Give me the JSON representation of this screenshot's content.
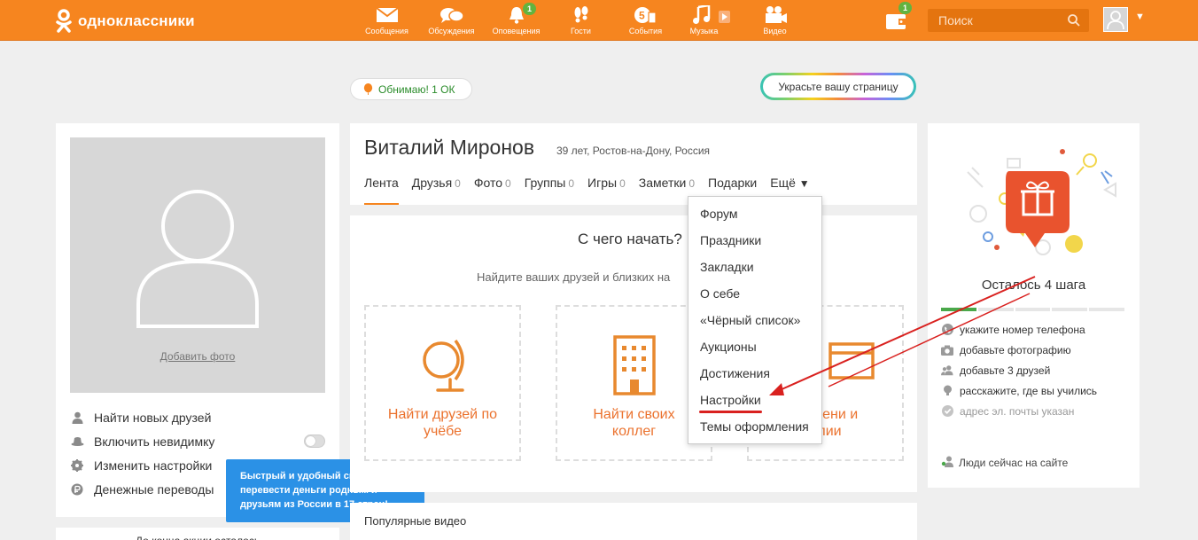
{
  "header": {
    "logo_text": "одноклассники",
    "nav": [
      {
        "label": "Сообщения",
        "icon": "envelope-icon",
        "badge": ""
      },
      {
        "label": "Обсуждения",
        "icon": "chat-bubbles-icon",
        "badge": ""
      },
      {
        "label": "Оповещения",
        "icon": "bell-icon",
        "badge": "1"
      },
      {
        "label": "Гости",
        "icon": "footprints-icon",
        "badge": ""
      },
      {
        "label": "События",
        "icon": "events-five-icon",
        "badge": ""
      },
      {
        "label": "Музыка",
        "icon": "music-note-icon",
        "badge": ""
      },
      {
        "label": "Видео",
        "icon": "video-camera-icon",
        "badge": ""
      }
    ],
    "wallet_badge": "1",
    "search_placeholder": "Поиск",
    "accent_color": "#f6851f"
  },
  "pills": {
    "ok_text": "Обнимаю! 1 ОК",
    "decorate_text": "Украсьте вашу страницу"
  },
  "left": {
    "add_photo": "Добавить фото",
    "menu": [
      {
        "label": "Найти новых друзей",
        "icon": "person-icon"
      },
      {
        "label": "Включить невидимку",
        "icon": "hat-icon"
      },
      {
        "label": "Изменить настройки",
        "icon": "gear-icon"
      },
      {
        "label": "Денежные переводы",
        "icon": "ruble-icon"
      }
    ],
    "bottom_text": "До конца акции осталось"
  },
  "tooltip": {
    "text": "Быстрый и удобный способ перевести деньги родным и друзьям из России в 17 стран!",
    "close": "×"
  },
  "profile": {
    "name": "Виталий Миронов",
    "info": "39 лет, Ростов-на-Дону, Россия",
    "tabs": [
      {
        "label": "Лента",
        "count": ""
      },
      {
        "label": "Друзья",
        "count": "0"
      },
      {
        "label": "Фото",
        "count": "0"
      },
      {
        "label": "Группы",
        "count": "0"
      },
      {
        "label": "Игры",
        "count": "0"
      },
      {
        "label": "Заметки",
        "count": "0"
      },
      {
        "label": "Подарки",
        "count": ""
      },
      {
        "label": "Ещё",
        "count": ""
      }
    ]
  },
  "start": {
    "title": "С чего начать?",
    "subtitle": "Найдите ваших друзей и близких на",
    "boxes": [
      {
        "line1": "Найти друзей по",
        "line2": "учёбе",
        "icon": "globe-icon"
      },
      {
        "line1": "Найти своих",
        "line2": "коллег",
        "icon": "building-icon"
      },
      {
        "line1": "о имени и",
        "line2": "илии",
        "icon": "id-card-icon"
      }
    ]
  },
  "videos": {
    "label": "Популярные видео"
  },
  "dropdown": {
    "items": [
      "Форум",
      "Праздники",
      "Закладки",
      "О себе",
      "«Чёрный список»",
      "Аукционы",
      "Достижения",
      "Настройки",
      "Темы оформления"
    ]
  },
  "right": {
    "steps_title": "Осталось 4 шага",
    "progress": {
      "done": 1,
      "total": 5
    },
    "steps": [
      {
        "label": "укажите номер телефона",
        "icon": "phone-icon",
        "done": false
      },
      {
        "label": "добавьте фотографию",
        "icon": "camera-icon",
        "done": false
      },
      {
        "label": "добавьте 3 друзей",
        "icon": "people-icon",
        "done": false
      },
      {
        "label": "расскажите, где вы учились",
        "icon": "graduation-icon",
        "done": false
      },
      {
        "label": "адрес эл. почты указан",
        "icon": "check-circle-icon",
        "done": true
      }
    ],
    "online": "Люди сейчас на сайте"
  }
}
